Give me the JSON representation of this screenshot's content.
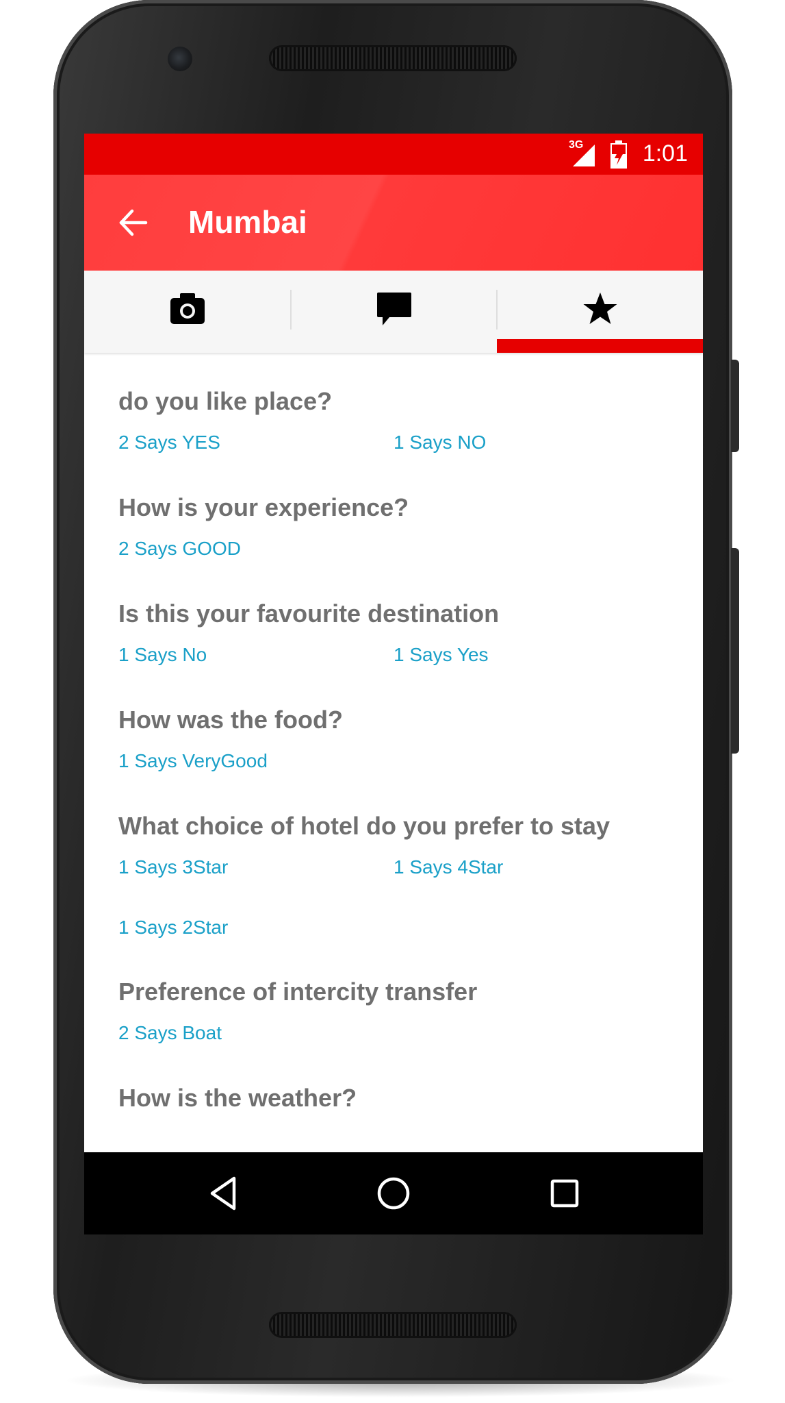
{
  "status_bar": {
    "network": "3G",
    "time": "1:01"
  },
  "app_bar": {
    "title": "Mumbai"
  },
  "tabs": [
    {
      "name": "photos",
      "icon": "camera-icon",
      "selected": false
    },
    {
      "name": "comments",
      "icon": "comment-icon",
      "selected": false
    },
    {
      "name": "ratings",
      "icon": "star-icon",
      "selected": true
    }
  ],
  "questions": [
    {
      "question": "do you like place?",
      "answers": [
        "2 Says YES",
        "1 Says NO"
      ]
    },
    {
      "question": "How is your experience?",
      "answers": [
        "2 Says GOOD"
      ]
    },
    {
      "question": "Is this your favourite destination",
      "answers": [
        "1 Says No",
        "1 Says Yes"
      ]
    },
    {
      "question": "How was the food?",
      "answers": [
        "1 Says VeryGood"
      ]
    },
    {
      "question": "What choice of hotel do you prefer to stay",
      "answers": [
        "1 Says 3Star",
        "1 Says 4Star",
        "1 Says 2Star"
      ]
    },
    {
      "question": "Preference of intercity transfer",
      "answers": [
        "2 Says Boat"
      ]
    },
    {
      "question": "How is the weather?",
      "answers": []
    }
  ],
  "colors": {
    "primary": "#ff3d3d",
    "status_bar": "#e60000",
    "accent": "#e60000",
    "question_text": "#6f6f6f",
    "answer_text": "#1aa0c8"
  }
}
